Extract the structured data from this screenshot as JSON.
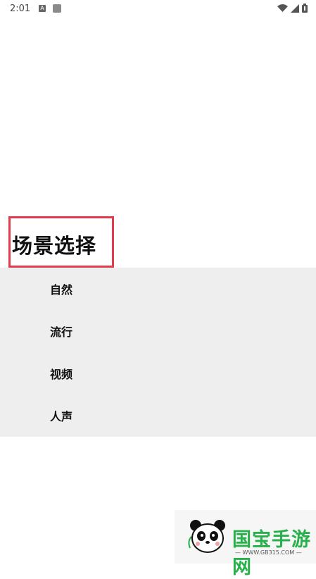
{
  "status_bar": {
    "time": "2:01",
    "notif_letter": "A"
  },
  "page": {
    "title": "场景选择"
  },
  "menu": {
    "items": [
      {
        "label": "自然"
      },
      {
        "label": "流行"
      },
      {
        "label": "视频"
      },
      {
        "label": "人声"
      }
    ]
  },
  "watermark": {
    "brand": "国宝手游网",
    "url": "— WWW.GB315.COM —"
  },
  "colors": {
    "highlight_border": "#e23b4c",
    "menu_background": "#eeeeee",
    "brand_green": "#28b14b"
  }
}
